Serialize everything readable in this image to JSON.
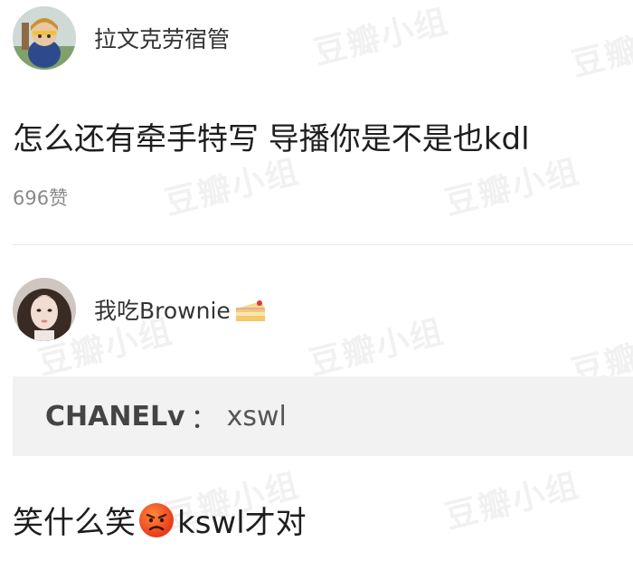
{
  "comments": [
    {
      "username": "拉文克劳宿管",
      "text": "怎么还有牵手特写 导播你是不是也kdl",
      "likes": "696赞"
    },
    {
      "username": "我吃Brownie",
      "username_emoji": "cake-emoji",
      "quote": {
        "author": "CHANELv",
        "separator": "：",
        "text": "xswl"
      },
      "text_before_emoji": "笑什么笑",
      "emoji": "angry-face-emoji",
      "text_after_emoji": "kswl才对"
    }
  ],
  "watermark": "豆瓣小组",
  "colors": {
    "quote_bg": "#f2f2f2",
    "divider": "#ececec",
    "likes": "#8a8a8a"
  }
}
